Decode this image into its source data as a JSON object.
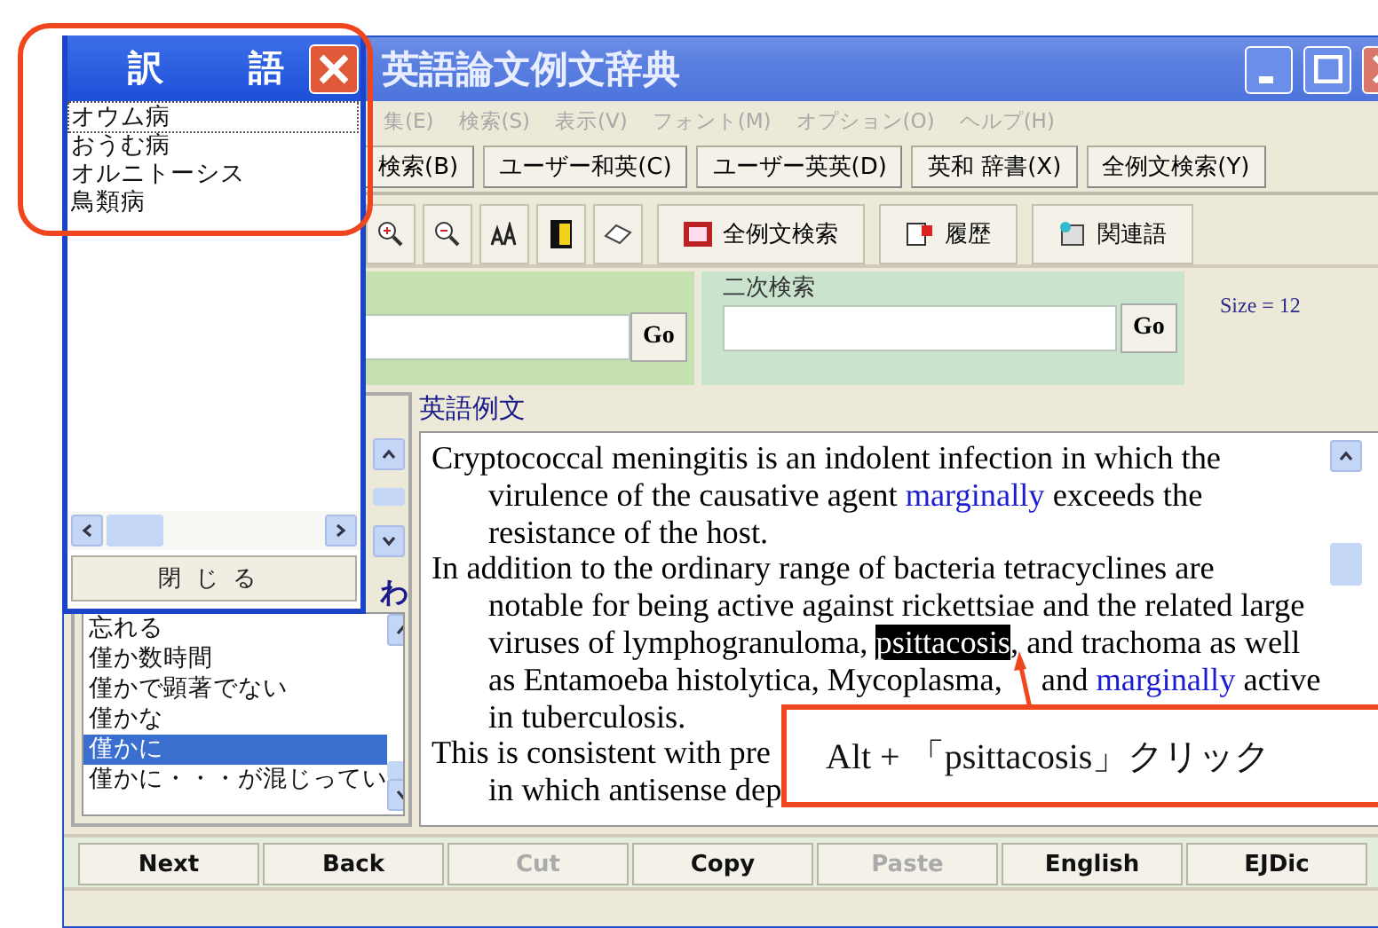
{
  "main_window": {
    "title": "英語論文例文辞典"
  },
  "menu": [
    "集(E)",
    "検索(S)",
    "表示(V)",
    "フォント(M)",
    "オプション(O)",
    "ヘルプ(H)"
  ],
  "dictionary_buttons": [
    "検索(B)",
    "ユーザー和英(C)",
    "ユーザー英英(D)",
    "英和 辞書(X)",
    "全例文検索(Y)"
  ],
  "toolbar_buttons": [
    {
      "label": "全例文検索",
      "kind": "film"
    },
    {
      "label": "履歴",
      "kind": "history"
    },
    {
      "label": "関連語",
      "kind": "related"
    }
  ],
  "search": {
    "button": "Go"
  },
  "secondary_search": {
    "label": "二次検索",
    "button": "Go"
  },
  "size_label": "Size = 12",
  "word_list": {
    "heading": "わ",
    "items": [
      {
        "label": "忘れる",
        "selected": false
      },
      {
        "label": "僅か数時間",
        "selected": false
      },
      {
        "label": "僅かで顕著でない",
        "selected": false
      },
      {
        "label": "僅かな",
        "selected": false
      },
      {
        "label": "僅かに",
        "selected": true
      },
      {
        "label": "僅かに・・・が混じってい",
        "selected": false
      }
    ]
  },
  "examples": {
    "label": "英語例文",
    "lines": [
      {
        "indent": false,
        "segments": [
          {
            "text": "Cryptococcal meningitis is an indolent infection in which the",
            "kind": "plain"
          }
        ]
      },
      {
        "indent": true,
        "segments": [
          {
            "text": "virulence of the causative agent ",
            "kind": "plain"
          },
          {
            "text": "marginally",
            "kind": "hit"
          },
          {
            "text": " exceeds the",
            "kind": "plain"
          }
        ]
      },
      {
        "indent": true,
        "segments": [
          {
            "text": "resistance of the host.",
            "kind": "plain"
          }
        ]
      },
      {
        "indent": false,
        "segments": [
          {
            "text": "In addition to the ordinary range of bacteria tetracyclines are",
            "kind": "plain"
          }
        ]
      },
      {
        "indent": true,
        "segments": [
          {
            "text": "notable for being active against rickettsiae and the related large",
            "kind": "plain"
          }
        ]
      },
      {
        "indent": true,
        "segments": [
          {
            "text": "viruses of lymphogranuloma, ",
            "kind": "plain"
          },
          {
            "text": "psittacosis",
            "kind": "selected"
          },
          {
            "text": ", and trachoma as well",
            "kind": "plain"
          }
        ]
      },
      {
        "indent": true,
        "segments": [
          {
            "text": "as Entamoeba histolytica, Mycoplasma,",
            "kind": "plain"
          }
        ],
        "after_arrow": [
          {
            "text": "and ",
            "kind": "plain"
          },
          {
            "text": "marginally",
            "kind": "hit"
          },
          {
            "text": " active",
            "kind": "plain"
          }
        ]
      },
      {
        "indent": true,
        "segments": [
          {
            "text": "in tuberculosis.",
            "kind": "plain"
          }
        ]
      },
      {
        "indent": false,
        "segments": [
          {
            "text": "This is consistent with pre",
            "kind": "plain"
          }
        ]
      },
      {
        "indent": true,
        "segments": [
          {
            "text": "in which antisense dep",
            "kind": "plain"
          }
        ]
      }
    ]
  },
  "bottom_buttons": [
    {
      "label": "Next",
      "disabled": false
    },
    {
      "label": "Back",
      "disabled": false
    },
    {
      "label": "Cut",
      "disabled": true
    },
    {
      "label": "Copy",
      "disabled": false
    },
    {
      "label": "Paste",
      "disabled": true
    },
    {
      "label": "English",
      "disabled": false
    },
    {
      "label": "EJDic",
      "disabled": false
    }
  ],
  "translation_popup": {
    "title": "訳　語",
    "items": [
      {
        "label": "オウム病",
        "selected": true
      },
      {
        "label": "おうむ病",
        "selected": false
      },
      {
        "label": "オルニトーシス",
        "selected": false
      },
      {
        "label": "鳥類病",
        "selected": false
      }
    ],
    "close_button": "閉じる"
  },
  "callout": {
    "text": "Alt + 「psittacosis」クリック"
  }
}
